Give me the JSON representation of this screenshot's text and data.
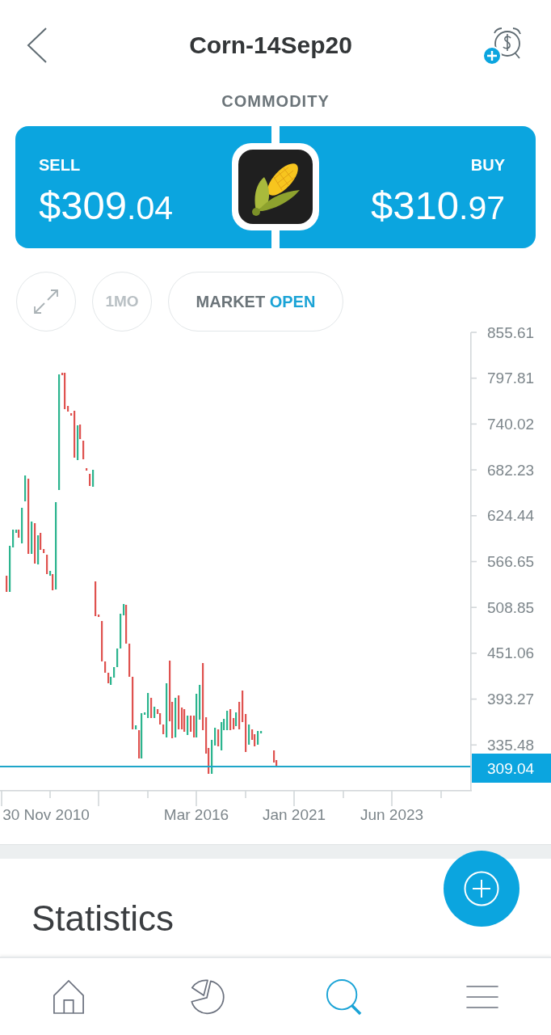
{
  "header": {
    "title": "Corn-14Sep20",
    "category": "COMMODITY"
  },
  "quote": {
    "sell": {
      "label": "SELL",
      "price": "$309",
      "fraction": ".04"
    },
    "buy": {
      "label": "BUY",
      "price": "$310",
      "fraction": ".97"
    }
  },
  "controls": {
    "timeframe": "1MO",
    "market": {
      "label": "MARKET",
      "status": "OPEN",
      "open": true
    }
  },
  "chart": {
    "y_labels": [
      "855.61",
      "797.81",
      "740.02",
      "682.23",
      "624.44",
      "566.65",
      "508.85",
      "451.06",
      "393.27",
      "335.48"
    ],
    "x_labels": [
      "30 Nov 2010",
      "Mar 2016",
      "Jan 2021",
      "Jun 2023"
    ],
    "current_price": "309.04"
  },
  "statistics": {
    "title": "Statistics"
  },
  "nav": [
    {
      "kind": "home",
      "selected": false
    },
    {
      "kind": "pie",
      "selected": false
    },
    {
      "kind": "search",
      "selected": true
    },
    {
      "kind": "menu",
      "selected": false
    }
  ]
}
